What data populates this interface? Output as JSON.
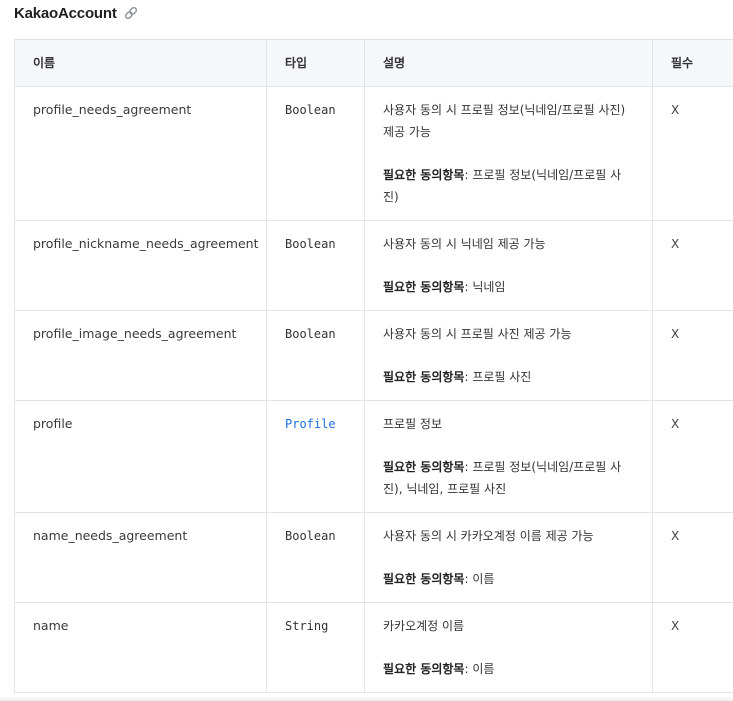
{
  "section": {
    "title": "KakaoAccount",
    "link_icon": "link-icon"
  },
  "table": {
    "headers": [
      "이름",
      "타입",
      "설명",
      "필수"
    ],
    "rows": [
      {
        "name": "profile_needs_agreement",
        "type": "Boolean",
        "type_is_link": false,
        "description": "사용자 동의 시 프로필 정보(닉네임/프로필 사진) 제공 가능",
        "required_label": "필요한 동의항목",
        "required_value": ": 프로필 정보(닉네임/프로필 사진)",
        "required": "X"
      },
      {
        "name": "profile_nickname_needs_agreement",
        "type": "Boolean",
        "type_is_link": false,
        "description": "사용자 동의 시 닉네임 제공 가능",
        "required_label": "필요한 동의항목",
        "required_value": ": 닉네임",
        "required": "X"
      },
      {
        "name": "profile_image_needs_agreement",
        "type": "Boolean",
        "type_is_link": false,
        "description": "사용자 동의 시 프로필 사진 제공 가능",
        "required_label": "필요한 동의항목",
        "required_value": ": 프로필 사진",
        "required": "X"
      },
      {
        "name": "profile",
        "type": "Profile",
        "type_is_link": true,
        "description": "프로필 정보",
        "required_label": "필요한 동의항목",
        "required_value": ": 프로필 정보(닉네임/프로필 사진), 닉네임, 프로필 사진",
        "required": "X"
      },
      {
        "name": "name_needs_agreement",
        "type": "Boolean",
        "type_is_link": false,
        "description": "사용자 동의 시 카카오계정 이름 제공 가능",
        "required_label": "필요한 동의항목",
        "required_value": ": 이름",
        "required": "X"
      },
      {
        "name": "name",
        "type": "String",
        "type_is_link": false,
        "description": "카카오계정 이름",
        "required_label": "필요한 동의항목",
        "required_value": ": 이름",
        "required": "X"
      }
    ]
  },
  "colors": {
    "link": "#1d6fe0",
    "header_bg": "#f6f7f9",
    "border": "#e2e4e8"
  }
}
